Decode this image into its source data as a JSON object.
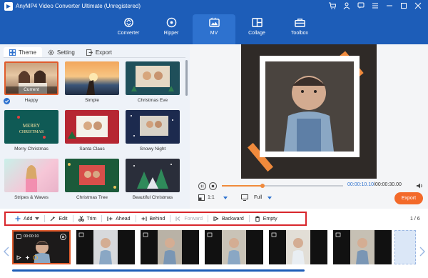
{
  "app": {
    "title": "AnyMP4 Video Converter Ultimate (Unregistered)",
    "window_icons": [
      "cart-icon",
      "user-icon",
      "chat-icon",
      "menu-icon",
      "minimize-icon",
      "maximize-icon",
      "close-icon"
    ]
  },
  "nav": {
    "items": [
      {
        "label": "Converter",
        "icon": "converter-icon",
        "active": false
      },
      {
        "label": "Ripper",
        "icon": "ripper-icon",
        "active": false
      },
      {
        "label": "MV",
        "icon": "mv-icon",
        "active": true
      },
      {
        "label": "Collage",
        "icon": "collage-icon",
        "active": false
      },
      {
        "label": "Toolbox",
        "icon": "toolbox-icon",
        "active": false
      }
    ]
  },
  "panel": {
    "tabs": [
      {
        "label": "Theme",
        "icon": "grid-icon",
        "active": true
      },
      {
        "label": "Setting",
        "icon": "gear-icon",
        "active": false
      },
      {
        "label": "Export",
        "icon": "export-icon",
        "active": false
      }
    ],
    "current_badge": "Current",
    "themes": [
      {
        "label": "Happy",
        "selected": true
      },
      {
        "label": "Simple",
        "selected": false
      },
      {
        "label": "Christmas Eve",
        "selected": false
      },
      {
        "label": "Merry Christmas",
        "selected": false
      },
      {
        "label": "Santa Claus",
        "selected": false
      },
      {
        "label": "Snowy Night",
        "selected": false
      },
      {
        "label": "Stripes & Waves",
        "selected": false
      },
      {
        "label": "Christmas Tree",
        "selected": false
      },
      {
        "label": "Beautiful Christmas",
        "selected": false
      }
    ]
  },
  "player": {
    "current_time": "00:00:10.10",
    "total_time": "/00:00:30.00",
    "progress": 0.337,
    "aspect_ratio": "1:1",
    "zoom": "Full",
    "export_label": "Export"
  },
  "toolbar": {
    "add": "Add",
    "edit": "Edit",
    "trim": "Trim",
    "ahead": "Ahead",
    "behind": "Behind",
    "forward": "Forward",
    "backward": "Backward",
    "empty": "Empty",
    "page": "1 / 6"
  },
  "timeline": {
    "first_clip_time": "00:00:10",
    "clip_count": 6
  },
  "colors": {
    "brand_blue": "#1d5db8",
    "accent_orange": "#f36a2a",
    "highlight_red": "#d8262c"
  }
}
